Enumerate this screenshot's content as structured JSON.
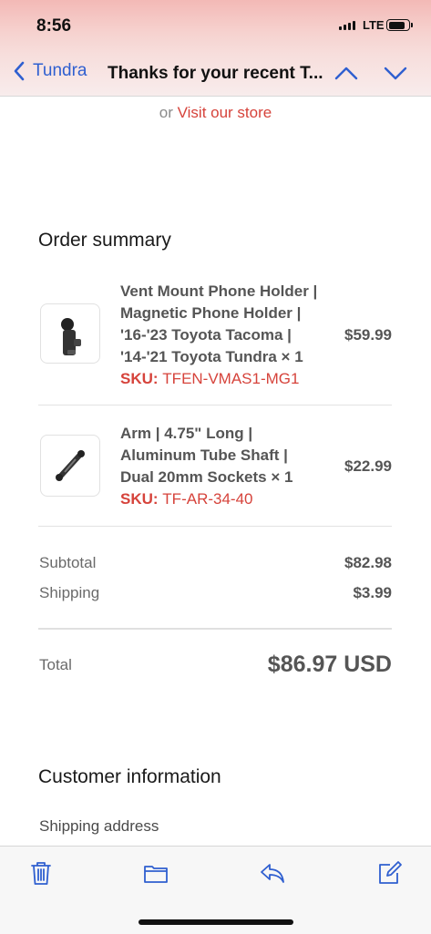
{
  "status": {
    "time": "8:56",
    "network": "LTE"
  },
  "nav": {
    "back_label": "Tundra",
    "title": "Thanks for your recent T..."
  },
  "store_link": {
    "prefix": "or",
    "link": "Visit our store"
  },
  "order_summary": {
    "title": "Order summary",
    "items": [
      {
        "name": "Vent Mount Phone Holder | Magnetic Phone Holder | '16-'23 Toyota Tacoma | '14-'21 Toyota Tundra × 1",
        "sku_label": "SKU:",
        "sku": "TFEN-VMAS1-MG1",
        "price": "$59.99"
      },
      {
        "name": "Arm | 4.75\" Long | Aluminum Tube Shaft | Dual 20mm Sockets × 1",
        "sku_label": "SKU:",
        "sku": "TF-AR-34-40",
        "price": "$22.99"
      }
    ],
    "subtotal_label": "Subtotal",
    "subtotal": "$82.98",
    "shipping_label": "Shipping",
    "shipping": "$3.99",
    "total_label": "Total",
    "total": "$86.97 USD"
  },
  "customer": {
    "title": "Customer information",
    "shipping_address_label": "Shipping address"
  },
  "toolbar": [
    "trash-icon",
    "folder-icon",
    "reply-icon",
    "compose-icon"
  ],
  "colors": {
    "accent_blue": "#2f5fd0",
    "link_red": "#d6433b"
  }
}
